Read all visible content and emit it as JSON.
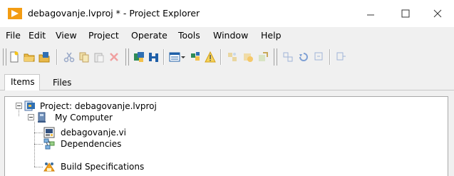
{
  "window": {
    "title": "debagovanje.lvproj * - Project Explorer",
    "controls": [
      "minimize-icon",
      "maximize-icon",
      "close-icon"
    ]
  },
  "menu": {
    "items": [
      "File",
      "Edit",
      "View",
      "Project",
      "Operate",
      "Tools",
      "Window",
      "Help"
    ]
  },
  "toolbar": {
    "icons": [
      "new-icon",
      "open-icon",
      "save-all-icon",
      "cut-icon",
      "copy-icon",
      "paste-icon",
      "delete-icon",
      "build-icon",
      "properties-icon",
      "view-menu-icon",
      "arrange-icon",
      "warning-icon",
      "source-control-icon-1",
      "source-control-icon-2",
      "source-control-icon-3",
      "expand-icon",
      "undo-icon",
      "collapse-icon",
      "more-icon"
    ]
  },
  "tabs": {
    "items": [
      "Items",
      "Files"
    ],
    "active": "Items"
  },
  "tree": {
    "project": "Project: debagovanje.lvproj",
    "computer": "My Computer",
    "vi": "debagovanje.vi",
    "dependencies": "Dependencies",
    "build": "Build Specifications"
  },
  "colors": {
    "window_bg": "#f0f0f0",
    "titlebar_bg": "#ffffff",
    "tree_bg": "#ffffff",
    "border": "#a9a9a9",
    "accent_orange": "#f5a623"
  }
}
